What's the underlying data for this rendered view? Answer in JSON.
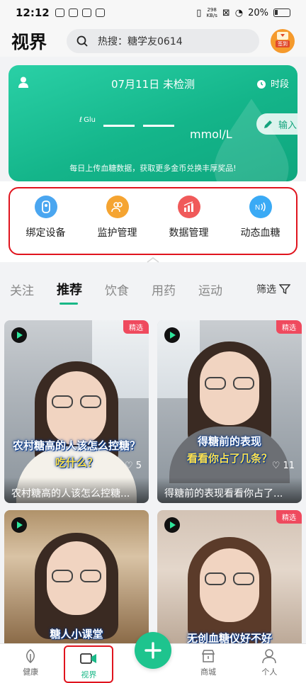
{
  "status_bar": {
    "time": "12:12",
    "net_speed": "298",
    "net_unit": "KB/s",
    "battery": "20%"
  },
  "header": {
    "title": "视界",
    "search_placeholder": "热搜：糖学友0614",
    "signin_label": "签到"
  },
  "glucose_card": {
    "date_status": "07月11日 未检测",
    "period_label": "时段",
    "glu_label": "Glu",
    "unit": "mmol/L",
    "input_label": "输入",
    "tip": "每日上传血糖数据，获取更多金币兑换丰厚奖品!"
  },
  "quick_menu": [
    {
      "label": "绑定设备",
      "icon": "device-icon",
      "color": "#4aa6f0"
    },
    {
      "label": "监护管理",
      "icon": "guardian-icon",
      "color": "#f5a431"
    },
    {
      "label": "数据管理",
      "icon": "chart-icon",
      "color": "#f05a5a"
    },
    {
      "label": "动态血糖",
      "icon": "signal-icon",
      "color": "#3aaaf5"
    }
  ],
  "tabs": [
    "关注",
    "推荐",
    "饮食",
    "用药",
    "运动"
  ],
  "active_tab": "推荐",
  "filter_label": "筛选",
  "feed": [
    {
      "badge": "精选",
      "overlay_line1": "农村糖高的人该怎么控糖？",
      "overlay_line2": "吃什么？",
      "likes": "5",
      "title": "农村糖高的人该怎么控糖..."
    },
    {
      "badge": "精选",
      "overlay_line1": "得糖前的表现",
      "overlay_line2": "看看你占了几条？",
      "likes": "11",
      "title": "得糖前的表现看看你占了..."
    },
    {
      "badge": "",
      "overlay_line1": "糖人小课堂",
      "overlay_line2": "",
      "likes": "",
      "title": ""
    },
    {
      "badge": "精选",
      "overlay_line1": "无创血糖仪好不好",
      "overlay_line2": "",
      "likes": "",
      "title": ""
    }
  ],
  "bottom_nav": [
    {
      "label": "健康",
      "icon": "leaf-icon"
    },
    {
      "label": "视界",
      "icon": "video-camera-icon"
    },
    {
      "label": "",
      "icon": "plus-icon"
    },
    {
      "label": "商城",
      "icon": "store-icon"
    },
    {
      "label": "个人",
      "icon": "person-icon"
    }
  ],
  "colors": {
    "brand_green": "#19b887",
    "highlight_red": "#e0141e",
    "badge_pink": "#ef4a5e"
  }
}
